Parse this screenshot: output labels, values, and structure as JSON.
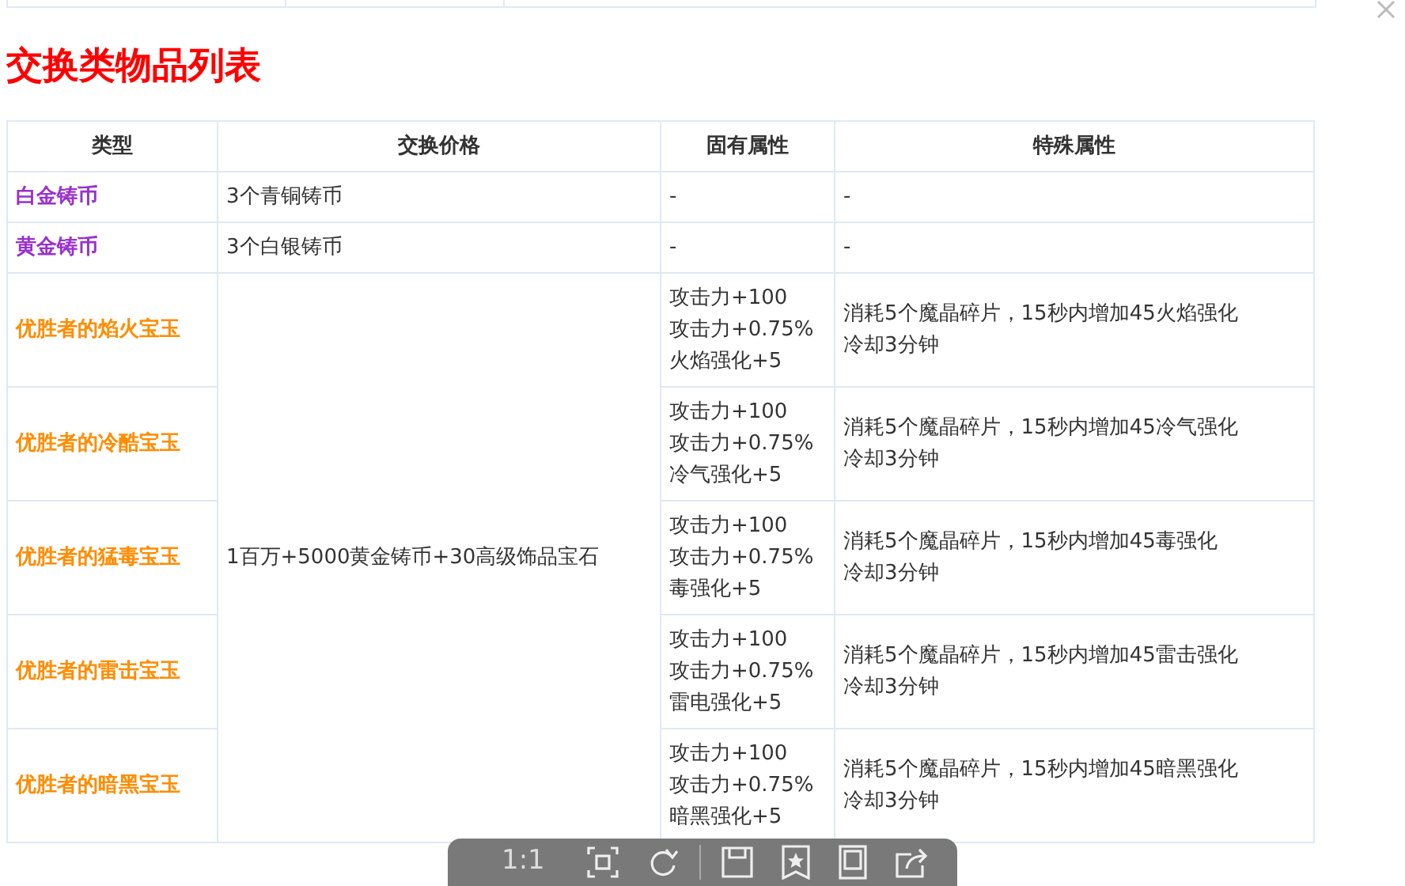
{
  "title": "交换类物品列表",
  "table": {
    "columns": [
      "类型",
      "交换价格",
      "固有属性",
      "特殊属性"
    ],
    "rows": [
      {
        "type": "白金铸币",
        "color": "#9932cc",
        "price": "3个青铜铸币",
        "attributes": [
          "-"
        ],
        "special": [
          "-"
        ]
      },
      {
        "type": "黄金铸币",
        "color": "#9932cc",
        "price": "3个白银铸币",
        "attributes": [
          "-"
        ],
        "special": [
          "-"
        ]
      },
      {
        "type": "优胜者的焰火宝玉",
        "color": "#ff8c00",
        "price": "1百万+5000黄金铸币+30高级饰品宝石",
        "attributes": [
          "攻击力+100",
          "攻击力+0.75%",
          "火焰强化+5"
        ],
        "special": [
          "消耗5个魔晶碎片，15秒内增加45火焰强化",
          "冷却3分钟"
        ]
      },
      {
        "type": "优胜者的冷酷宝玉",
        "color": "#ff8c00",
        "attributes": [
          "攻击力+100",
          "攻击力+0.75%",
          "冷气强化+5"
        ],
        "special": [
          "消耗5个魔晶碎片，15秒内增加45冷气强化",
          "冷却3分钟"
        ]
      },
      {
        "type": "优胜者的猛毒宝玉",
        "color": "#ff8c00",
        "attributes": [
          "攻击力+100",
          "攻击力+0.75%",
          "毒强化+5"
        ],
        "special": [
          "消耗5个魔晶碎片，15秒内增加45毒强化",
          "冷却3分钟"
        ]
      },
      {
        "type": "优胜者的雷击宝玉",
        "color": "#ff8c00",
        "attributes": [
          "攻击力+100",
          "攻击力+0.75%",
          "雷电强化+5"
        ],
        "special": [
          "消耗5个魔晶碎片，15秒内增加45雷击强化",
          "冷却3分钟"
        ]
      },
      {
        "type": "优胜者的暗黑宝玉",
        "color": "#ff8c00",
        "attributes": [
          "攻击力+100",
          "攻击力+0.75%",
          "暗黑强化+5"
        ],
        "special": [
          "消耗5个魔晶碎片，15秒内增加45暗黑强化",
          "冷却3分钟"
        ]
      }
    ]
  },
  "viewer_toolbar": {
    "zoom_label": "1:1"
  }
}
